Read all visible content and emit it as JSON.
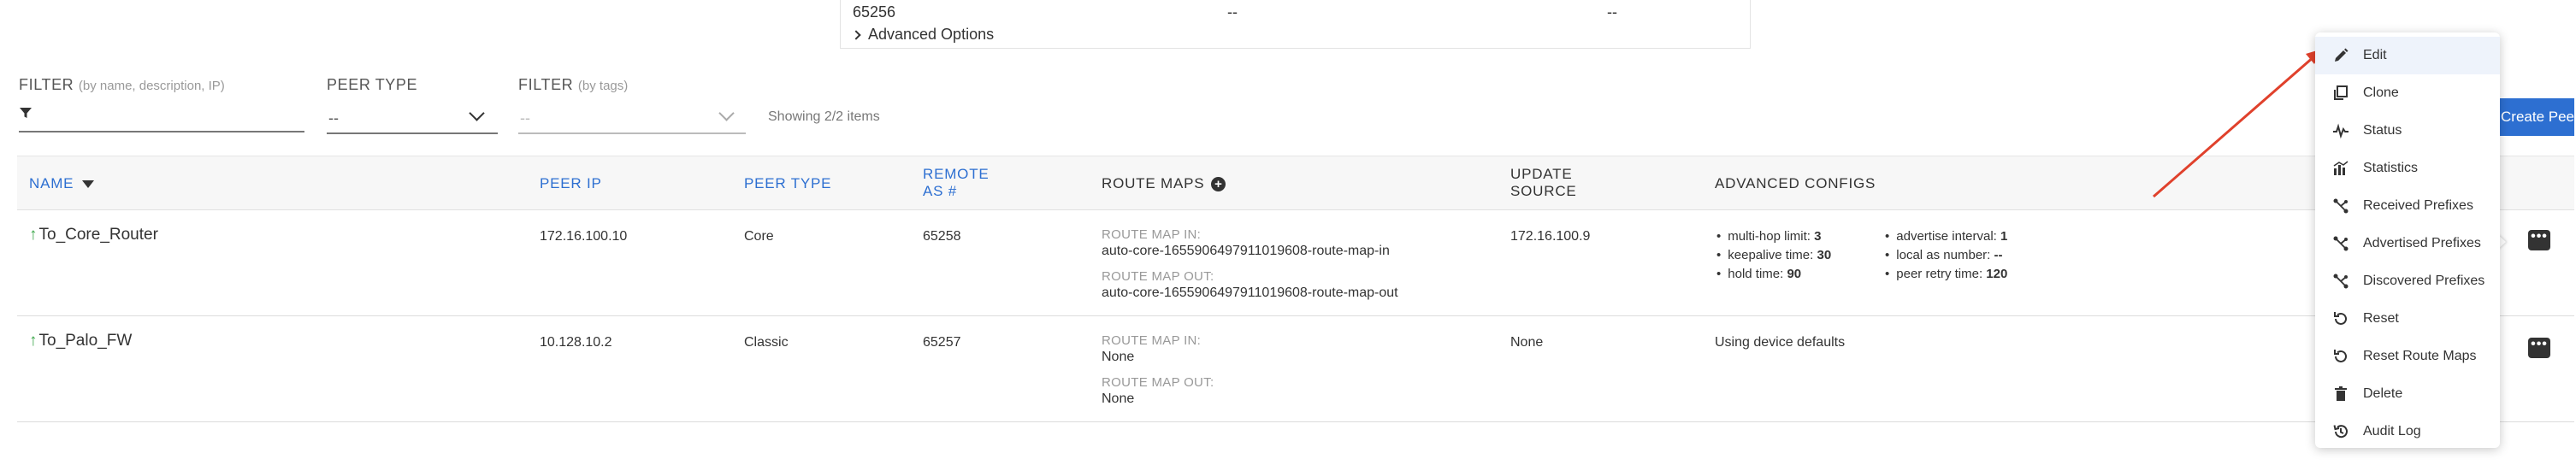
{
  "top_fragment": {
    "values": [
      "65256",
      "--",
      "--"
    ],
    "advanced_options": "Advanced Options"
  },
  "filters": {
    "filter_label": "FILTER",
    "filter_hint": "(by name, description, IP)",
    "peer_type_label": "PEER TYPE",
    "peer_type_value": "--",
    "tags_label": "FILTER",
    "tags_hint": "(by tags)",
    "tags_value": "--",
    "showing": "Showing 2/2 items"
  },
  "create_button": "Create Peer",
  "table": {
    "headers": {
      "name": "NAME",
      "peer_ip": "PEER IP",
      "peer_type": "PEER TYPE",
      "remote_as_1": "REMOTE",
      "remote_as_2": "AS #",
      "route_maps": "ROUTE MAPS",
      "update_source_1": "UPDATE",
      "update_source_2": "SOURCE",
      "advanced_configs": "ADVANCED CONFIGS"
    },
    "rows": [
      {
        "name": "To_Core_Router",
        "peer_ip": "172.16.100.10",
        "peer_type": "Core",
        "remote_as": "65258",
        "rm_in_label": "ROUTE MAP IN:",
        "rm_in": "auto-core-1655906497911019608-route-map-in",
        "rm_out_label": "ROUTE MAP OUT:",
        "rm_out": "auto-core-1655906497911019608-route-map-out",
        "update_source": "172.16.100.9",
        "adv_left": [
          {
            "k": "multi-hop limit: ",
            "v": "3"
          },
          {
            "k": "keepalive time: ",
            "v": "30"
          },
          {
            "k": "hold time: ",
            "v": "90"
          }
        ],
        "adv_right": [
          {
            "k": "advertise interval: ",
            "v": "1"
          },
          {
            "k": "local as number: ",
            "v": "--"
          },
          {
            "k": "peer retry time: ",
            "v": "120"
          }
        ]
      },
      {
        "name": "To_Palo_FW",
        "peer_ip": "10.128.10.2",
        "peer_type": "Classic",
        "remote_as": "65257",
        "rm_in_label": "ROUTE MAP IN:",
        "rm_in": "None",
        "rm_out_label": "ROUTE MAP OUT:",
        "rm_out": "None",
        "update_source": "None",
        "adv_text": "Using device defaults"
      }
    ]
  },
  "menu": {
    "items": [
      {
        "label": "Edit",
        "icon": "pencil-icon"
      },
      {
        "label": "Clone",
        "icon": "clone-icon"
      },
      {
        "label": "Status",
        "icon": "pulse-icon"
      },
      {
        "label": "Statistics",
        "icon": "bar-chart-icon"
      },
      {
        "label": "Received Prefixes",
        "icon": "network-icon"
      },
      {
        "label": "Advertised Prefixes",
        "icon": "network-icon"
      },
      {
        "label": "Discovered Prefixes",
        "icon": "network-icon"
      },
      {
        "label": "Reset",
        "icon": "reset-icon"
      },
      {
        "label": "Reset Route Maps",
        "icon": "reset-icon"
      },
      {
        "label": "Delete",
        "icon": "trash-icon"
      },
      {
        "label": "Audit Log",
        "icon": "history-icon"
      }
    ]
  },
  "colors": {
    "accent": "#2d6fd1",
    "status_up": "#3aa648",
    "annotation_arrow": "#e0412c"
  }
}
